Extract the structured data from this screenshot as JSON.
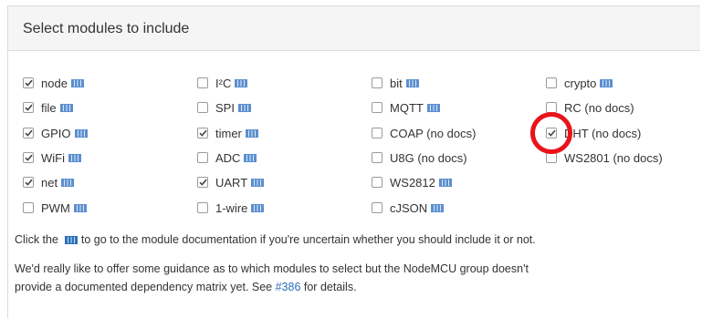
{
  "panel": {
    "title": "Select modules to include"
  },
  "columns": [
    [
      {
        "label": "node",
        "checked": true,
        "docs": true
      },
      {
        "label": "file",
        "checked": true,
        "docs": true
      },
      {
        "label": "GPIO",
        "checked": true,
        "docs": true
      },
      {
        "label": "WiFi",
        "checked": true,
        "docs": true
      },
      {
        "label": "net",
        "checked": true,
        "docs": true
      },
      {
        "label": "PWM",
        "checked": false,
        "docs": true
      }
    ],
    [
      {
        "label": "I²C",
        "checked": false,
        "docs": true
      },
      {
        "label": "SPI",
        "checked": false,
        "docs": true
      },
      {
        "label": "timer",
        "checked": true,
        "docs": true
      },
      {
        "label": "ADC",
        "checked": false,
        "docs": true
      },
      {
        "label": "UART",
        "checked": true,
        "docs": true
      },
      {
        "label": "1-wire",
        "checked": false,
        "docs": true
      }
    ],
    [
      {
        "label": "bit",
        "checked": false,
        "docs": true
      },
      {
        "label": "MQTT",
        "checked": false,
        "docs": true
      },
      {
        "label": "COAP (no docs)",
        "checked": false,
        "docs": false
      },
      {
        "label": "U8G (no docs)",
        "checked": false,
        "docs": false
      },
      {
        "label": "WS2812",
        "checked": false,
        "docs": true
      },
      {
        "label": "cJSON",
        "checked": false,
        "docs": true
      }
    ],
    [
      {
        "label": "crypto",
        "checked": false,
        "docs": true
      },
      {
        "label": "RC (no docs)",
        "checked": false,
        "docs": false
      },
      {
        "label": "DHT (no docs)",
        "checked": true,
        "docs": false
      },
      {
        "label": "WS2801 (no docs)",
        "checked": false,
        "docs": false
      }
    ]
  ],
  "info": {
    "line1_before": "Click the ",
    "line1_after": " to go to the module documentation if you're uncertain whether you should include it or not.",
    "line2": "We'd really like to offer some guidance as to which modules to select but the NodeMCU group doesn't",
    "line3_before": "provide a documented dependency matrix yet. See ",
    "line3_link": "#386",
    "line3_after": " for details."
  },
  "colors": {
    "accent": "#2a6ebb",
    "highlight": "#e8141b"
  },
  "icons": {
    "docs": "book-icon",
    "check": "checkmark-icon"
  }
}
